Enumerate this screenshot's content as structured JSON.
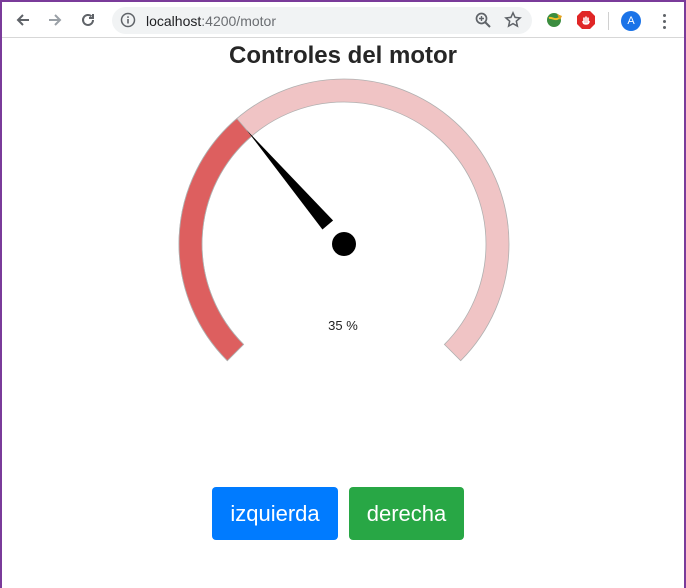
{
  "browser": {
    "url_host": "localhost",
    "url_path": ":4200/motor",
    "profile_initial": "A"
  },
  "page": {
    "title": "Controles del motor"
  },
  "gauge": {
    "value": 35,
    "value_label": "35 %",
    "min": 0,
    "max": 100,
    "fill_color": "#dd5f5f",
    "track_color": "#f0c4c5",
    "needle_color": "#000000"
  },
  "buttons": {
    "left_label": "izquierda",
    "right_label": "derecha",
    "left_color": "#007bff",
    "right_color": "#28a745"
  }
}
